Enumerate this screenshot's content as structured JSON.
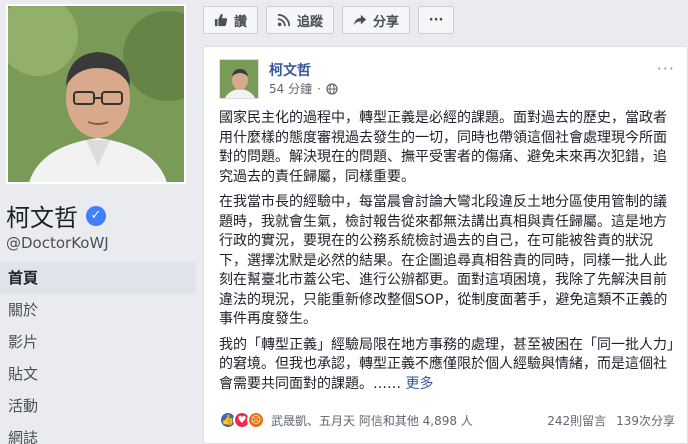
{
  "profile": {
    "name": "柯文哲",
    "handle": "@DoctorKoWJ"
  },
  "nav": [
    {
      "label": "首頁"
    },
    {
      "label": "關於"
    },
    {
      "label": "影片"
    },
    {
      "label": "貼文"
    },
    {
      "label": "活動"
    },
    {
      "label": "網誌"
    }
  ],
  "actions": {
    "like": "讚",
    "follow": "追蹤",
    "share": "分享",
    "more": "···"
  },
  "post": {
    "author": "柯文哲",
    "time": "54 分鐘",
    "dot": "·",
    "menu": "···",
    "paragraphs": [
      "國家民主化的過程中，轉型正義是必經的課題。面對過去的歷史，當政者用什麼樣的態度審視過去發生的一切，同時也帶領這個社會處理現今所面對的問題。解決現在的問題、撫平受害者的傷痛、避免未來再次犯錯，追究過去的責任歸屬，同樣重要。",
      "在我當市長的經驗中，每當晨會討論大彎北段違反土地分區使用管制的議題時，我就會生氣，檢討報告從來都無法講出真相與責任歸屬。這是地方行政的實況，要現在的公務系統檢討過去的自己，在可能被咎責的狀況下，選擇沈默是必然的結果。在企圖追尋真相咎責的同時，同樣一批人此刻在幫臺北市蓋公宅、進行公辦都更。面對這項困境，我除了先解決目前違法的現況，只能重新修改整個SOP，從制度面著手，避免這類不正義的事件再度發生。"
    ],
    "last_paragraph": "我的「轉型正義」經驗局限在地方事務的處理，甚至被困在「同一批人力」的窘境。但我也承認，轉型正義不應僅限於個人經驗與情緒，而是這個社會需要共同面對的課題。……",
    "more": "更多",
    "reactors": "武晟凱、五月天 阿信和其他 4,898 人",
    "comments": "242則留言",
    "shares": "139次分享"
  }
}
